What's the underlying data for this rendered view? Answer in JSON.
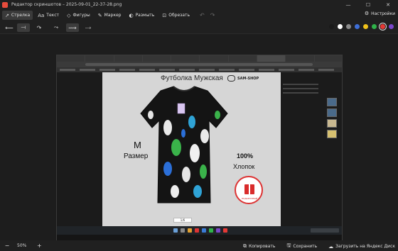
{
  "window": {
    "title": "Редактор скриншотов – 2025-09-01_22-37-28.png",
    "minimize": "—",
    "maximize": "☐",
    "close": "✕"
  },
  "toolbar": {
    "tools": [
      {
        "label": "Стрелка",
        "icon": "↗"
      },
      {
        "label": "Текст",
        "icon": "Aa"
      },
      {
        "label": "Фигуры",
        "icon": "◇"
      },
      {
        "label": "Маркер",
        "icon": "✎"
      },
      {
        "label": "Размыть",
        "icon": "◐"
      },
      {
        "label": "Обрезать",
        "icon": "⊡"
      }
    ],
    "undo": "↶",
    "redo": "↷",
    "settings_label": "Настройки",
    "settings_icon": "⚙"
  },
  "arrow_styles": [
    "⟵",
    "⟞",
    "↷",
    "⤳",
    "⟿",
    "⤏"
  ],
  "colors": {
    "palette": [
      "#1a1a1a",
      "#ffffff",
      "#8a8a8a",
      "#3e6fd8",
      "#f0c21a",
      "#2fb24a",
      "#e53935",
      "#7a46c9"
    ],
    "selected_index": 6
  },
  "screenshot": {
    "photo_title": "Футболка Мужская",
    "brand": "SAM-SHOP",
    "size_letter": "M",
    "size_word": "Размер",
    "cotton_pct": "100%",
    "cotton_word": "Хлопок",
    "badge_text": "ПОДАРОЧНЫЙ",
    "page_counter": "1/6"
  },
  "bottombar": {
    "zoom_minus": "−",
    "zoom_value": "50%",
    "zoom_plus": "+",
    "copy_label": "Копировать",
    "copy_icon": "⧉",
    "save_label": "Сохранить",
    "save_icon": "🖫",
    "upload_label": "Загрузить на Яндекс Диск",
    "upload_icon": "☁"
  }
}
